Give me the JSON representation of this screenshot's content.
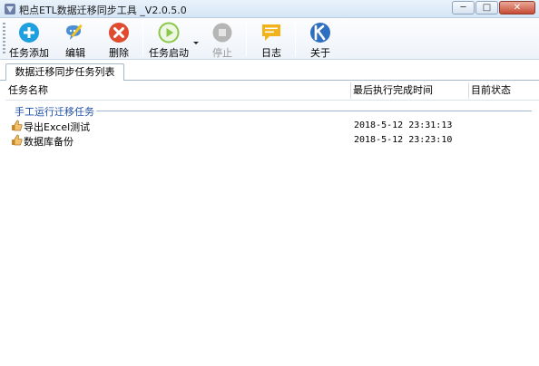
{
  "window": {
    "title": "粑点ETL数据迁移同步工具 _V2.0.5.0",
    "minimize_glyph": "─",
    "maximize_glyph": "□",
    "close_glyph": "✕"
  },
  "toolbar": {
    "add_label": "任务添加",
    "edit_label": "编辑",
    "delete_label": "删除",
    "start_label": "任务启动",
    "stop_label": "停止",
    "log_label": "日志",
    "about_label": "关于"
  },
  "tabs": [
    {
      "label": "数据迁移同步任务列表",
      "active": true
    }
  ],
  "list": {
    "columns": [
      "任务名称",
      "最后执行完成时间",
      "目前状态"
    ],
    "groups": [
      {
        "label": "手工运行迁移任务",
        "rows": [
          {
            "name": "导出Excel测试",
            "last_run": "2018-5-12 23:31:13",
            "status": ""
          },
          {
            "name": "数据库备份",
            "last_run": "2018-5-12 23:23:10",
            "status": ""
          }
        ]
      }
    ]
  },
  "colors": {
    "add": "#1e9fe0",
    "delete": "#e04a2e",
    "start": "#8ac74a",
    "stop_disabled": "#b5b5b5",
    "log": "#f2b21c",
    "about": "#2f6fc2",
    "group_text": "#1f4fa8"
  },
  "icons": {
    "add": "plus-circle-icon",
    "edit": "pencil-chat-icon",
    "delete": "x-circle-icon",
    "start": "play-circle-icon",
    "stop": "stop-circle-icon",
    "log": "chat-bubble-icon",
    "about": "logo-k-icon",
    "task": "thumbs-up-icon"
  }
}
